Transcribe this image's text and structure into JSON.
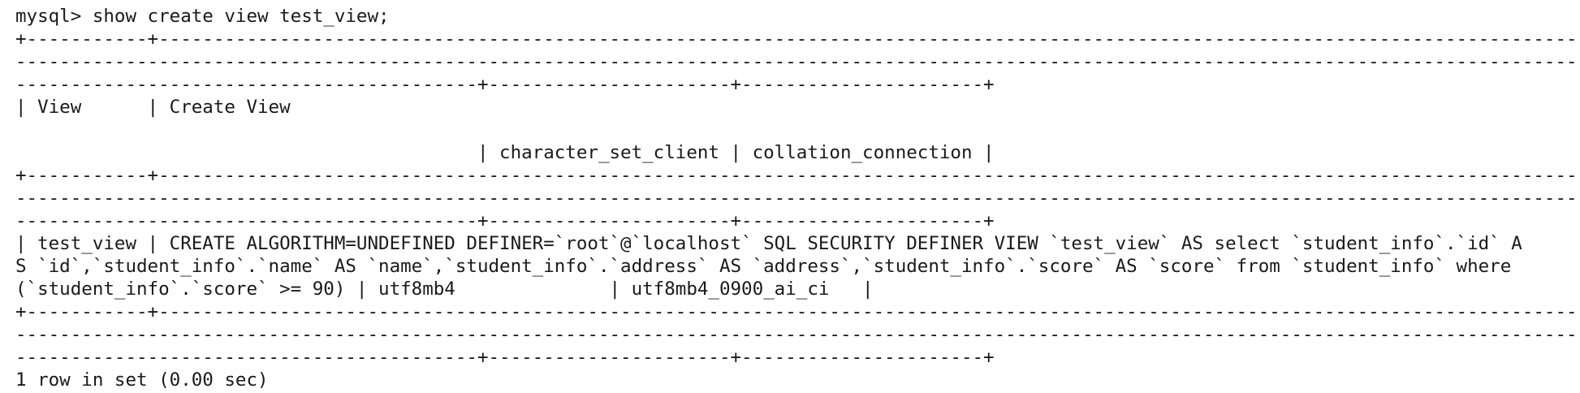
{
  "terminal": {
    "lines": [
      "mysql> show create view test_view;",
      "+-----------+---------------------------------------------------------------------------------------------------------------------------------------------------------------------------------------------------------------------------------------------------------------------------------------------",
      "-------------------------------------------------------------------------------------------------------------------------------------------------------------------------------------------------------------------------------------------------------------------------------------------------------",
      "------------------------------------------+----------------------+----------------------+",
      "| View      | Create View",
      "",
      "                                          | character_set_client | collation_connection |",
      "+-----------+---------------------------------------------------------------------------------------------------------------------------------------------------------------------------------------------------------------------------------------------------------------------------------------------",
      "-------------------------------------------------------------------------------------------------------------------------------------------------------------------------------------------------------------------------------------------------------------------------------------------------------",
      "------------------------------------------+----------------------+----------------------+",
      "| test_view | CREATE ALGORITHM=UNDEFINED DEFINER=`root`@`localhost` SQL SECURITY DEFINER VIEW `test_view` AS select `student_info`.`id` A",
      "S `id`,`student_info`.`name` AS `name`,`student_info`.`address` AS `address`,`student_info`.`score` AS `score` from `student_info` where",
      "(`student_info`.`score` >= 90) | utf8mb4              | utf8mb4_0900_ai_ci   |",
      "+-----------+---------------------------------------------------------------------------------------------------------------------------------------------------------------------------------------------------------------------------------------------------------------------------------------------",
      "-------------------------------------------------------------------------------------------------------------------------------------------------------------------------------------------------------------------------------------------------------------------------------------------------------",
      "------------------------------------------+----------------------+----------------------+",
      "1 row in set (0.00 sec)"
    ]
  }
}
